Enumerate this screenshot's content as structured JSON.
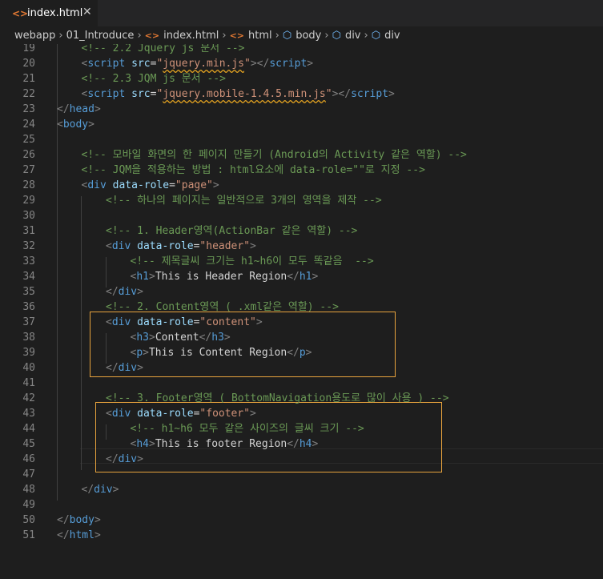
{
  "tab": {
    "title": "index.html",
    "close": "✕"
  },
  "breadcrumb": [
    "webapp",
    "01_Introduce",
    "index.html",
    "html",
    "body",
    "div",
    "div"
  ],
  "lines": [
    {
      "n": "19",
      "i": 1,
      "s": [
        [
          "com",
          "<!-- 2.2 Jquery js 문서 -->"
        ]
      ]
    },
    {
      "n": "20",
      "i": 1,
      "s": [
        [
          "br",
          "<"
        ],
        [
          "tag",
          "script"
        ],
        [
          "txt",
          " "
        ],
        [
          "attr",
          "src"
        ],
        [
          "txt",
          "="
        ],
        [
          "str",
          "\""
        ],
        [
          "strul",
          "jquery.min.js"
        ],
        [
          "str",
          "\""
        ],
        [
          "br",
          "></"
        ],
        [
          "tag",
          "script"
        ],
        [
          "br",
          ">"
        ]
      ]
    },
    {
      "n": "21",
      "i": 1,
      "s": [
        [
          "com",
          "<!-- 2.3 JQM js 문서 -->"
        ]
      ]
    },
    {
      "n": "22",
      "i": 1,
      "s": [
        [
          "br",
          "<"
        ],
        [
          "tag",
          "script"
        ],
        [
          "txt",
          " "
        ],
        [
          "attr",
          "src"
        ],
        [
          "txt",
          "="
        ],
        [
          "str",
          "\""
        ],
        [
          "strul",
          "jquery.mobile-1.4.5.min.js"
        ],
        [
          "str",
          "\""
        ],
        [
          "br",
          "></"
        ],
        [
          "tag",
          "script"
        ],
        [
          "br",
          ">"
        ]
      ]
    },
    {
      "n": "23",
      "i": 0,
      "s": [
        [
          "br",
          "</"
        ],
        [
          "tag",
          "head"
        ],
        [
          "br",
          ">"
        ]
      ]
    },
    {
      "n": "24",
      "i": 0,
      "s": [
        [
          "br",
          "<"
        ],
        [
          "tag",
          "body"
        ],
        [
          "br",
          ">"
        ]
      ]
    },
    {
      "n": "25",
      "i": 0,
      "s": []
    },
    {
      "n": "26",
      "i": 1,
      "s": [
        [
          "com",
          "<!-- 모바일 화면의 한 페이지 만들기 (Android의 Activity 같은 역할) -->"
        ]
      ]
    },
    {
      "n": "27",
      "i": 1,
      "s": [
        [
          "com",
          "<!-- JQM을 적용하는 방법 : html요소에 data-role=\"\"로 지정 -->"
        ]
      ]
    },
    {
      "n": "28",
      "i": 1,
      "s": [
        [
          "br",
          "<"
        ],
        [
          "tag",
          "div"
        ],
        [
          "txt",
          " "
        ],
        [
          "attr",
          "data-role"
        ],
        [
          "txt",
          "="
        ],
        [
          "str",
          "\"page\""
        ],
        [
          "br",
          ">"
        ]
      ]
    },
    {
      "n": "29",
      "i": 2,
      "s": [
        [
          "com",
          "<!-- 하나의 페이지는 일반적으로 3개의 영역을 제작 -->"
        ]
      ]
    },
    {
      "n": "30",
      "i": 0,
      "s": []
    },
    {
      "n": "31",
      "i": 2,
      "s": [
        [
          "com",
          "<!-- 1. Header영역(ActionBar 같은 역할) -->"
        ]
      ]
    },
    {
      "n": "32",
      "i": 2,
      "s": [
        [
          "br",
          "<"
        ],
        [
          "tag",
          "div"
        ],
        [
          "txt",
          " "
        ],
        [
          "attr",
          "data-role"
        ],
        [
          "txt",
          "="
        ],
        [
          "str",
          "\"header\""
        ],
        [
          "br",
          ">"
        ]
      ]
    },
    {
      "n": "33",
      "i": 3,
      "s": [
        [
          "com",
          "<!-- 제목글씨 크기는 h1~h6이 모두 똑같음  -->"
        ]
      ]
    },
    {
      "n": "34",
      "i": 3,
      "s": [
        [
          "br",
          "<"
        ],
        [
          "tag",
          "h1"
        ],
        [
          "br",
          ">"
        ],
        [
          "txt",
          "This is Header Region"
        ],
        [
          "br",
          "</"
        ],
        [
          "tag",
          "h1"
        ],
        [
          "br",
          ">"
        ]
      ]
    },
    {
      "n": "35",
      "i": 2,
      "s": [
        [
          "br",
          "</"
        ],
        [
          "tag",
          "div"
        ],
        [
          "br",
          ">"
        ]
      ]
    },
    {
      "n": "36",
      "i": 2,
      "s": [
        [
          "com",
          "<!-- 2. Content영역 ( .xml같은 역할) -->"
        ]
      ]
    },
    {
      "n": "37",
      "i": 2,
      "s": [
        [
          "br",
          "<"
        ],
        [
          "tag",
          "div"
        ],
        [
          "txt",
          " "
        ],
        [
          "attr",
          "data-role"
        ],
        [
          "txt",
          "="
        ],
        [
          "str",
          "\"content\""
        ],
        [
          "br",
          ">"
        ]
      ]
    },
    {
      "n": "38",
      "i": 3,
      "s": [
        [
          "br",
          "<"
        ],
        [
          "tag",
          "h3"
        ],
        [
          "br",
          ">"
        ],
        [
          "txt",
          "Content"
        ],
        [
          "br",
          "</"
        ],
        [
          "tag",
          "h3"
        ],
        [
          "br",
          ">"
        ]
      ]
    },
    {
      "n": "39",
      "i": 3,
      "s": [
        [
          "br",
          "<"
        ],
        [
          "tag",
          "p"
        ],
        [
          "br",
          ">"
        ],
        [
          "txt",
          "This is Content Region"
        ],
        [
          "br",
          "</"
        ],
        [
          "tag",
          "p"
        ],
        [
          "br",
          ">"
        ]
      ]
    },
    {
      "n": "40",
      "i": 2,
      "s": [
        [
          "br",
          "</"
        ],
        [
          "tag",
          "div"
        ],
        [
          "br",
          ">"
        ]
      ]
    },
    {
      "n": "41",
      "i": 0,
      "s": []
    },
    {
      "n": "42",
      "i": 2,
      "s": [
        [
          "com",
          "<!-- 3. Footer영역 ( BottomNavigation용도로 많이 사용 ) -->"
        ]
      ]
    },
    {
      "n": "43",
      "i": 2,
      "s": [
        [
          "br",
          "<"
        ],
        [
          "tag",
          "div"
        ],
        [
          "txt",
          " "
        ],
        [
          "attr",
          "data-role"
        ],
        [
          "txt",
          "="
        ],
        [
          "str",
          "\"footer\""
        ],
        [
          "br",
          ">"
        ]
      ]
    },
    {
      "n": "44",
      "i": 3,
      "s": [
        [
          "com",
          "<!-- h1~h6 모두 같은 사이즈의 글씨 크기 -->"
        ]
      ]
    },
    {
      "n": "45",
      "i": 3,
      "s": [
        [
          "br",
          "<"
        ],
        [
          "tag",
          "h4"
        ],
        [
          "br",
          ">"
        ],
        [
          "txt",
          "This is footer Region"
        ],
        [
          "br",
          "</"
        ],
        [
          "tag",
          "h4"
        ],
        [
          "br",
          ">"
        ]
      ]
    },
    {
      "n": "46",
      "i": 2,
      "s": [
        [
          "br",
          "</"
        ],
        [
          "tag",
          "div"
        ],
        [
          "br",
          ">"
        ]
      ]
    },
    {
      "n": "47",
      "i": 0,
      "s": []
    },
    {
      "n": "48",
      "i": 1,
      "s": [
        [
          "br",
          "</"
        ],
        [
          "tag",
          "div"
        ],
        [
          "br",
          ">"
        ]
      ]
    },
    {
      "n": "49",
      "i": 0,
      "s": []
    },
    {
      "n": "50",
      "i": 0,
      "s": [
        [
          "br",
          "</"
        ],
        [
          "tag",
          "body"
        ],
        [
          "br",
          ">"
        ]
      ]
    },
    {
      "n": "51",
      "i": 0,
      "s": [
        [
          "br",
          "</"
        ],
        [
          "tag",
          "html"
        ],
        [
          "br",
          ">"
        ]
      ]
    }
  ],
  "colors": {
    "highlight_border": "#e8a33d",
    "html_icon": "#e37933",
    "tag_icon": "#75beff"
  }
}
